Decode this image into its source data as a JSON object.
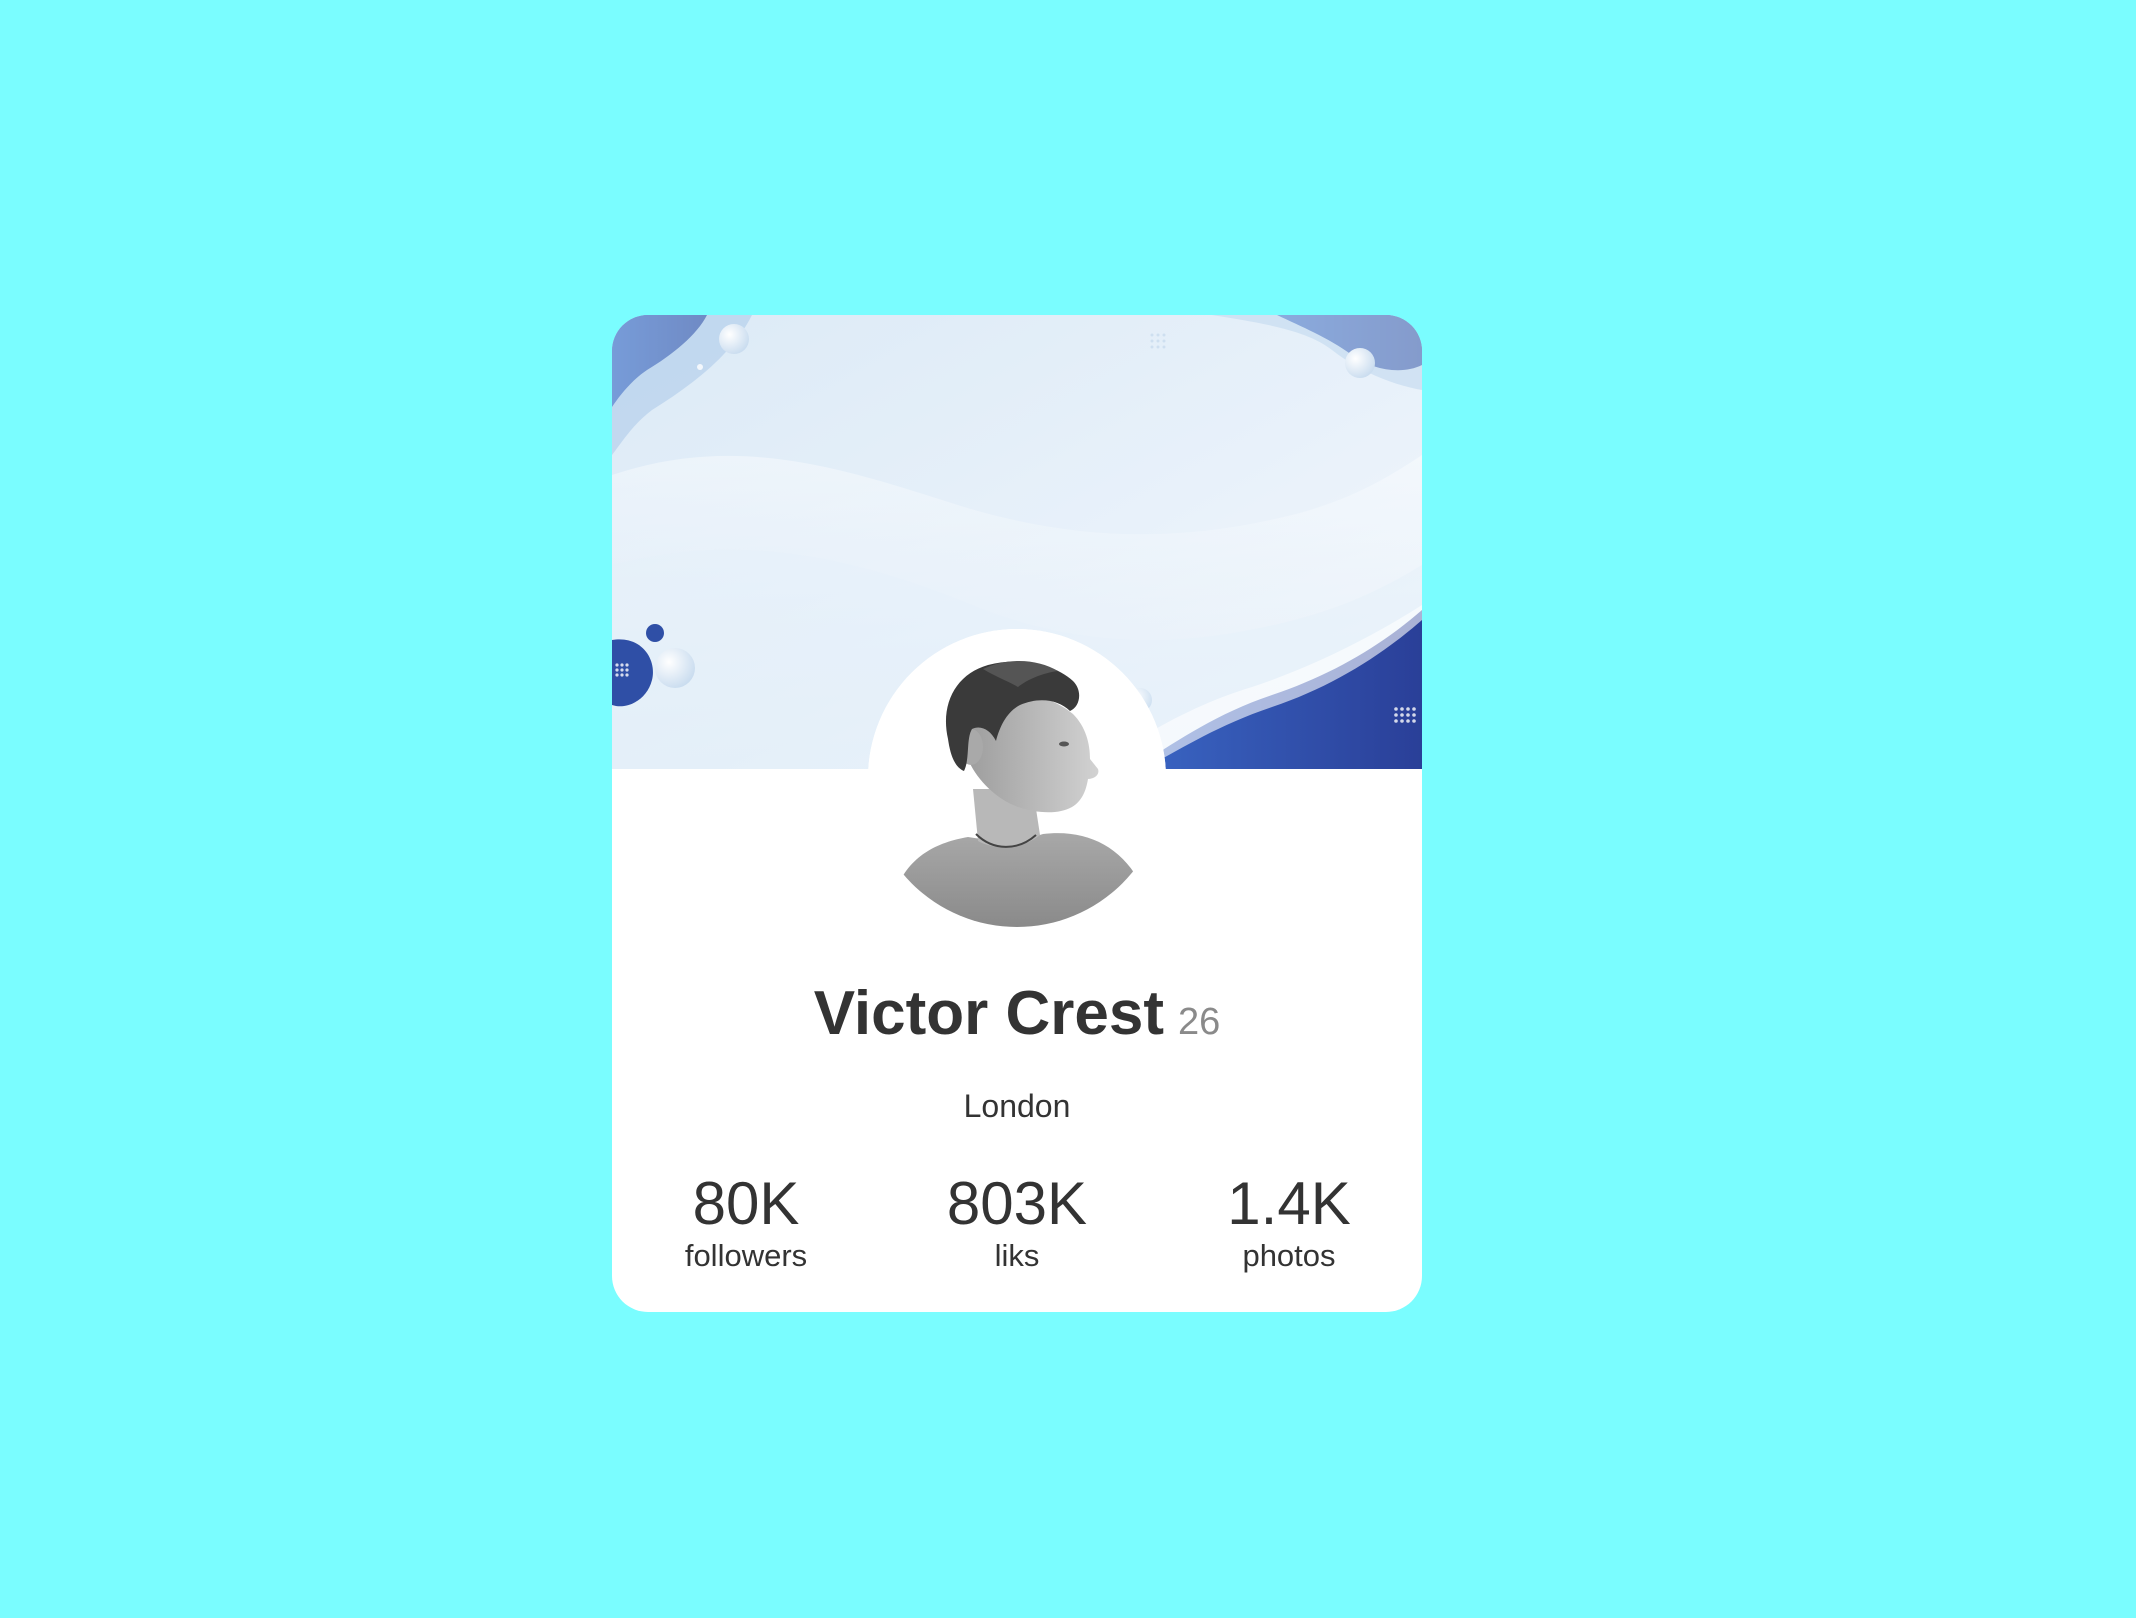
{
  "profile": {
    "name": "Victor Crest",
    "age": "26",
    "city": "London"
  },
  "stats": [
    {
      "value": "80K",
      "label": "followers"
    },
    {
      "value": "803K",
      "label": "liks"
    },
    {
      "value": "1.4K",
      "label": "photos"
    }
  ],
  "colors": {
    "page_background": "#7afdff",
    "card_background": "#ffffff",
    "banner_dark_blue": "#2f4fa6",
    "banner_light_blue": "#cfe2f3",
    "text_primary": "#333333",
    "text_secondary": "#8a8a8a"
  },
  "icons": {
    "avatar": "profile-photo"
  }
}
